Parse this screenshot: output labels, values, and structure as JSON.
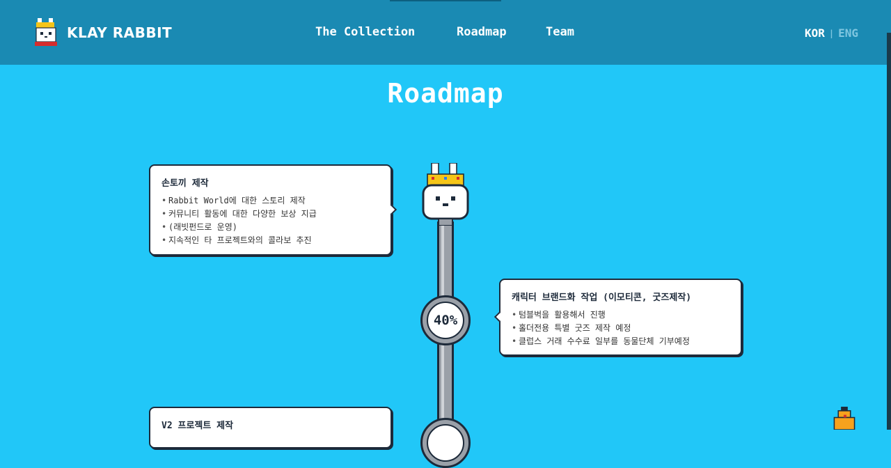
{
  "header": {
    "brand": "KLAY RABBIT",
    "nav": [
      "The Collection",
      "Roadmap",
      "Team"
    ],
    "lang_kor": "KOR",
    "lang_sep": "|",
    "lang_eng": "ENG"
  },
  "main": {
    "title": "Roadmap",
    "milestones": [
      {
        "title": "손토끼 제작",
        "items": [
          "Rabbit World에 대한 스토리 제작",
          "커뮤니티 활동에 대한 다양한 보상 지급",
          "(래빗펀드로 운영)",
          "지속적인 타 프로젝트와의 콜라보 추진"
        ]
      },
      {
        "title": "캐릭터 브랜드화 작업 (이모티콘, 굿즈제작)",
        "items": [
          "텀블벅을 활용해서 진행",
          "홀더전용 특별 굿즈 제작 예정",
          "클럽스 거래 수수료 일부를 동물단체 기부예정"
        ]
      },
      {
        "title": "V2 프로젝트 제작",
        "items": []
      }
    ],
    "progress_label": "40%"
  },
  "colors": {
    "background": "#21c7f8",
    "header": "#1a8ab3",
    "ink": "#1d2a3a"
  }
}
